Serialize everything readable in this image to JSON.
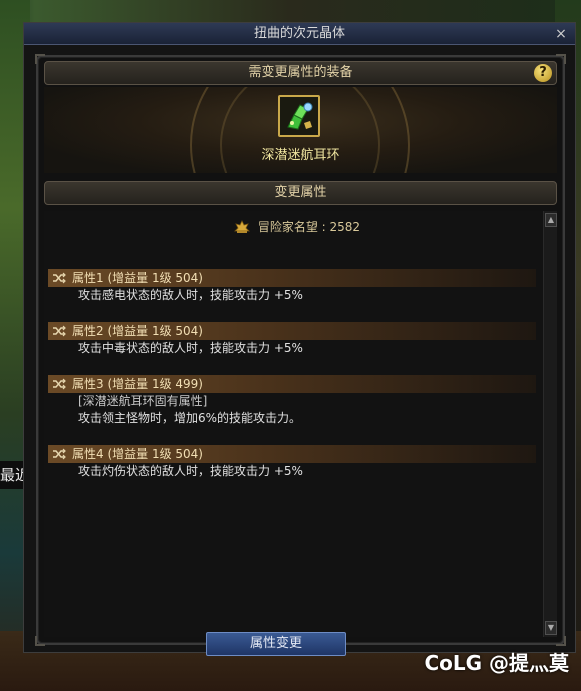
{
  "window": {
    "title": "扭曲的次元晶体",
    "close_glyph": "×"
  },
  "equipment_section": {
    "header": "需变更属性的装备",
    "help_glyph": "?",
    "item_name": "深潜迷航耳环"
  },
  "change_section": {
    "header": "变更属性",
    "fame_label": "冒险家名望 : 2582",
    "attributes": [
      {
        "title": "属性1 (增益量 1级 504)",
        "lines": [
          "攻击感电状态的敌人时，技能攻击力 +5%"
        ]
      },
      {
        "title": "属性2 (增益量 1级 504)",
        "lines": [
          "攻击中毒状态的敌人时，技能攻击力 +5%"
        ]
      },
      {
        "title": "属性3 (增益量 1级 499)",
        "lines": [
          "[深潜迷航耳环固有属性]",
          "攻击领主怪物时，增加6%的技能攻击力。"
        ]
      },
      {
        "title": "属性4 (增益量 1级 504)",
        "lines": [
          "攻击灼伤状态的敌人时，技能攻击力 +5%"
        ]
      }
    ]
  },
  "scroll": {
    "up_glyph": "▲",
    "down_glyph": "▼"
  },
  "footer": {
    "change_button": "属性变更"
  },
  "background": {
    "side_text": "最近"
  },
  "watermark": {
    "text": "CoLG @提灬莫"
  },
  "colors": {
    "accent_gold": "#c9a84a",
    "header_text": "#e3d3a8",
    "button_blue": "#2a4780"
  }
}
